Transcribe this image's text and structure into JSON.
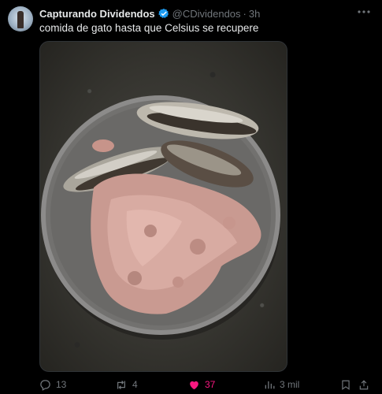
{
  "post": {
    "author_name": "Capturando Dividendos",
    "handle": "@CDividendos",
    "separator": "·",
    "time": "3h",
    "text": "comida de gato hasta que Celsius se recupere",
    "media_icon": "photo"
  },
  "actions": {
    "replies": "13",
    "reposts": "4",
    "likes": "37",
    "views": "3 mil"
  },
  "colors": {
    "background": "#000000",
    "text": "#e7e9ea",
    "muted": "#71767b",
    "verified": "#1d9bf0",
    "like": "#f91880"
  },
  "icons": [
    "verified-badge-icon",
    "more-icon",
    "reply-icon",
    "repost-icon",
    "heart-icon",
    "views-icon",
    "bookmark-icon",
    "share-icon"
  ]
}
